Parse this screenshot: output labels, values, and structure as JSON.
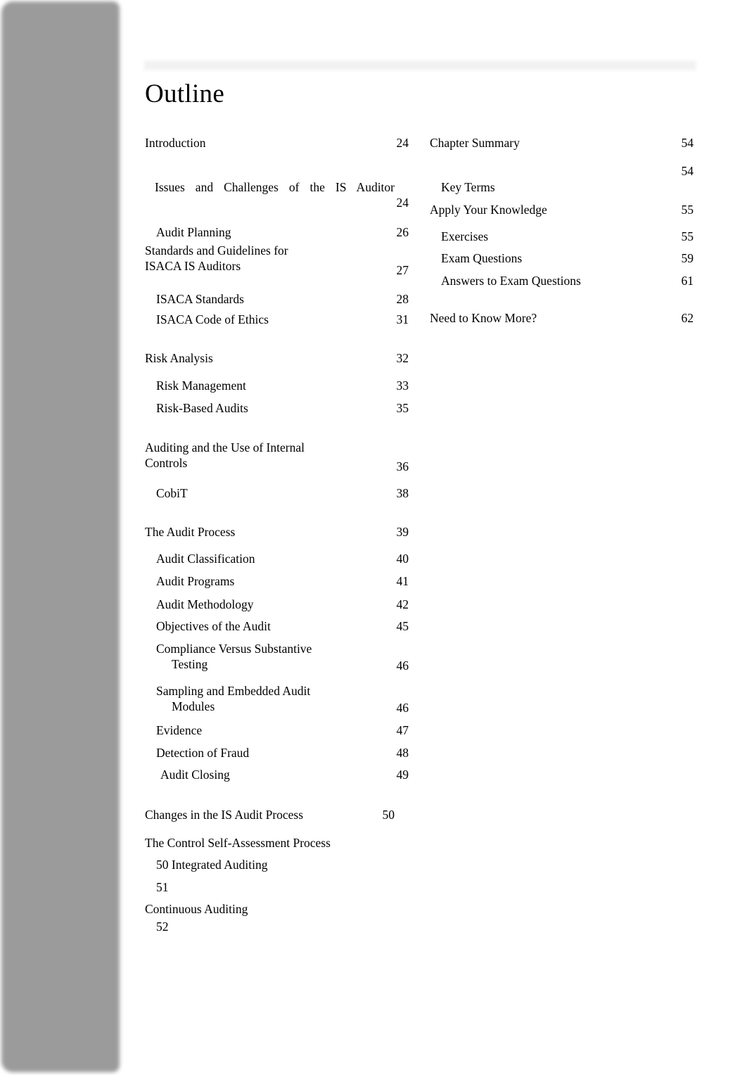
{
  "page": {
    "title": "Outline",
    "background_color": "#ffffff",
    "sidebar_color": "#9b9b9b",
    "header_band_color": "#f2f2f2"
  },
  "columns": {
    "left": [
      {
        "label": "Introduction",
        "page": "24"
      },
      {
        "label": "Issues and Challenges of the IS Auditor",
        "page": "24"
      },
      {
        "label": "Audit Planning",
        "page": "26"
      },
      {
        "label": "Standards and Guidelines for ISACA IS  Auditors",
        "page": "27"
      },
      {
        "label": "ISACA Standards",
        "page": "28"
      },
      {
        "label": "ISACA Code of Ethics",
        "page": "31"
      },
      {
        "label": "Risk Analysis",
        "page": "32"
      },
      {
        "label": "Risk Management",
        "page": "33"
      },
      {
        "label": "Risk-Based Audits",
        "page": "35"
      },
      {
        "label": "Auditing and the Use of Internal Controls",
        "page": "36"
      },
      {
        "label": "CobiT",
        "page": "38"
      },
      {
        "label": "The Audit Process",
        "page": "39"
      },
      {
        "label": "Audit Classification",
        "page": "40"
      },
      {
        "label": "Audit Programs",
        "page": "41"
      },
      {
        "label": "Audit Methodology",
        "page": "42"
      },
      {
        "label": "Objectives of the Audit",
        "page": "45"
      },
      {
        "label": "Compliance Versus Substantive Testing",
        "page": "46"
      },
      {
        "label": "Sampling and Embedded Audit Modules",
        "page": "46"
      },
      {
        "label": "Evidence",
        "page": "47"
      },
      {
        "label": "Detection of Fraud",
        "page": "48"
      },
      {
        "label": "Audit Closing",
        "page": "49"
      },
      {
        "label": "Changes in the IS Audit Process",
        "page": "50"
      },
      {
        "label": "The Control Self-Assessment Process",
        "page": ""
      },
      {
        "label": "50   Integrated Auditing",
        "page": ""
      },
      {
        "label": "51",
        "page": ""
      },
      {
        "label": "Continuous Auditing",
        "page": ""
      },
      {
        "label": "52",
        "page": ""
      }
    ],
    "right": [
      {
        "label": "Chapter Summary",
        "page": "54"
      },
      {
        "label": "",
        "page": "54"
      },
      {
        "label": "Key Terms",
        "page": ""
      },
      {
        "label": "Apply Your Knowledge",
        "page": "55"
      },
      {
        "label": "Exercises",
        "page": "55"
      },
      {
        "label": "Exam Questions",
        "page": "59"
      },
      {
        "label": "Answers to Exam Questions",
        "page": "61"
      },
      {
        "label": "Need to Know More?",
        "page": "62"
      }
    ]
  }
}
